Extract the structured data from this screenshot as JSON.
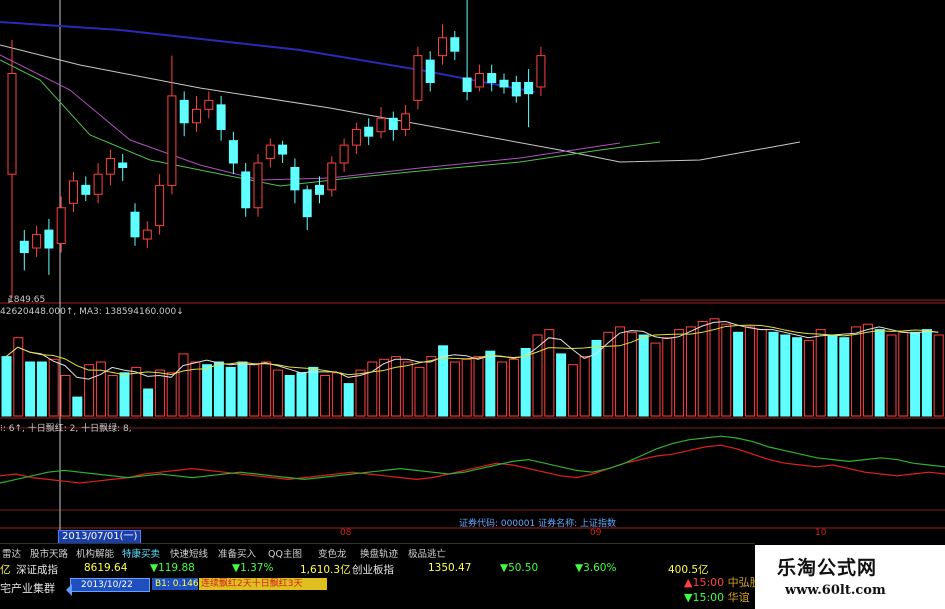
{
  "chart_data": {
    "type": "candlestick",
    "title": "",
    "min_marker": "1849.65",
    "candles": [
      {
        "o": 1905,
        "c": 1950,
        "h": 1965,
        "l": 1849.65
      },
      {
        "o": 1875,
        "c": 1870,
        "h": 1880,
        "l": 1862
      },
      {
        "o": 1872,
        "c": 1878,
        "h": 1882,
        "l": 1868
      },
      {
        "o": 1880,
        "c": 1872,
        "h": 1885,
        "l": 1860
      },
      {
        "o": 1874,
        "c": 1890,
        "h": 1895,
        "l": 1870
      },
      {
        "o": 1892,
        "c": 1902,
        "h": 1906,
        "l": 1888
      },
      {
        "o": 1900,
        "c": 1896,
        "h": 1904,
        "l": 1893
      },
      {
        "o": 1896,
        "c": 1905,
        "h": 1910,
        "l": 1892
      },
      {
        "o": 1905,
        "c": 1912,
        "h": 1916,
        "l": 1900
      },
      {
        "o": 1910,
        "c": 1908,
        "h": 1914,
        "l": 1902
      },
      {
        "o": 1888,
        "c": 1877,
        "h": 1892,
        "l": 1873
      },
      {
        "o": 1876,
        "c": 1880,
        "h": 1884,
        "l": 1872
      },
      {
        "o": 1882,
        "c": 1900,
        "h": 1905,
        "l": 1878
      },
      {
        "o": 1900,
        "c": 1940,
        "h": 1958,
        "l": 1896
      },
      {
        "o": 1938,
        "c": 1928,
        "h": 1942,
        "l": 1922
      },
      {
        "o": 1928,
        "c": 1934,
        "h": 1940,
        "l": 1924
      },
      {
        "o": 1934,
        "c": 1938,
        "h": 1942,
        "l": 1930
      },
      {
        "o": 1936,
        "c": 1925,
        "h": 1940,
        "l": 1920
      },
      {
        "o": 1920,
        "c": 1910,
        "h": 1924,
        "l": 1905
      },
      {
        "o": 1906,
        "c": 1890,
        "h": 1910,
        "l": 1886
      },
      {
        "o": 1890,
        "c": 1910,
        "h": 1914,
        "l": 1886
      },
      {
        "o": 1912,
        "c": 1918,
        "h": 1921,
        "l": 1908
      },
      {
        "o": 1918,
        "c": 1914,
        "h": 1920,
        "l": 1910
      },
      {
        "o": 1908,
        "c": 1898,
        "h": 1912,
        "l": 1892
      },
      {
        "o": 1898,
        "c": 1886,
        "h": 1900,
        "l": 1880
      },
      {
        "o": 1900,
        "c": 1896,
        "h": 1904,
        "l": 1892
      },
      {
        "o": 1898,
        "c": 1910,
        "h": 1913,
        "l": 1895
      },
      {
        "o": 1910,
        "c": 1918,
        "h": 1921,
        "l": 1906
      },
      {
        "o": 1918,
        "c": 1925,
        "h": 1928,
        "l": 1914
      },
      {
        "o": 1926,
        "c": 1922,
        "h": 1930,
        "l": 1918
      },
      {
        "o": 1924,
        "c": 1930,
        "h": 1935,
        "l": 1921
      },
      {
        "o": 1930,
        "c": 1925,
        "h": 1933,
        "l": 1920
      },
      {
        "o": 1925,
        "c": 1932,
        "h": 1936,
        "l": 1922
      },
      {
        "o": 1938,
        "c": 1958,
        "h": 1962,
        "l": 1934
      },
      {
        "o": 1956,
        "c": 1946,
        "h": 1960,
        "l": 1942
      },
      {
        "o": 1958,
        "c": 1966,
        "h": 1972,
        "l": 1954
      },
      {
        "o": 1966,
        "c": 1960,
        "h": 1969,
        "l": 1956
      },
      {
        "o": 1948,
        "c": 1942,
        "h": 2012,
        "l": 1938
      },
      {
        "o": 1944,
        "c": 1950,
        "h": 1954,
        "l": 1942
      },
      {
        "o": 1950,
        "c": 1946,
        "h": 1954,
        "l": 1942
      },
      {
        "o": 1947,
        "c": 1944,
        "h": 1950,
        "l": 1941
      },
      {
        "o": 1946,
        "c": 1940,
        "h": 1949,
        "l": 1937
      },
      {
        "o": 1946,
        "c": 1941,
        "h": 1952,
        "l": 1926
      },
      {
        "o": 1944,
        "c": 1958,
        "h": 1962,
        "l": 1940
      }
    ],
    "volume_label": "42620448.000↑, MA3: 138594160.000↓",
    "volumes": [
      44,
      58,
      40,
      40,
      42,
      30,
      14,
      38,
      40,
      30,
      32,
      36,
      20,
      34,
      32,
      46,
      40,
      38,
      40,
      36,
      40,
      38,
      40,
      34,
      30,
      32,
      36,
      30,
      32,
      24,
      34,
      40,
      42,
      44,
      40,
      36,
      44,
      52,
      40,
      42,
      44,
      48,
      40,
      42,
      50,
      60,
      64,
      46,
      38,
      44,
      56,
      62,
      66,
      62,
      60,
      54,
      58,
      64,
      66,
      70,
      72,
      68,
      62,
      66,
      64,
      62,
      60,
      58,
      56,
      64,
      60,
      58,
      66,
      68,
      64,
      60,
      62,
      62,
      64,
      60
    ],
    "volume_colors": [
      "c",
      "r",
      "c",
      "c",
      "r",
      "r",
      "c",
      "r",
      "r",
      "r",
      "c",
      "r",
      "c",
      "r",
      "r",
      "r",
      "r",
      "c",
      "c",
      "c",
      "c",
      "r",
      "r",
      "r",
      "c",
      "c",
      "c",
      "r",
      "r",
      "c",
      "r",
      "r",
      "r",
      "r",
      "r",
      "r",
      "r",
      "c",
      "r",
      "r",
      "r",
      "c",
      "r",
      "r",
      "c",
      "r",
      "r",
      "c",
      "r",
      "r",
      "c",
      "r",
      "r",
      "r",
      "c",
      "r",
      "r",
      "r",
      "r",
      "r",
      "r",
      "r",
      "c",
      "r",
      "r",
      "c",
      "c",
      "c",
      "r",
      "r",
      "c",
      "c",
      "r",
      "r",
      "c",
      "r",
      "r",
      "c",
      "c",
      "r"
    ],
    "indicator_label": "⁝: 6↑, 十日飘红: 2, 十日飘绿: 8,",
    "red_line": [
      38,
      40,
      36,
      34,
      32,
      30,
      32,
      34,
      36,
      40,
      42,
      44,
      46,
      44,
      42,
      40,
      38,
      36,
      34,
      36,
      38,
      40,
      42,
      40,
      38,
      36,
      34,
      36,
      40,
      44,
      48,
      52,
      50,
      46,
      42,
      38,
      36,
      40,
      46,
      52,
      56,
      60,
      62,
      66,
      70,
      72,
      68,
      62,
      56,
      52,
      50,
      48,
      50,
      46,
      42,
      40,
      38,
      40,
      42,
      40
    ],
    "green_line": [
      30,
      34,
      38,
      42,
      44,
      42,
      40,
      38,
      36,
      38,
      40,
      38,
      36,
      38,
      40,
      42,
      40,
      38,
      36,
      34,
      36,
      38,
      40,
      42,
      44,
      46,
      44,
      42,
      40,
      42,
      46,
      50,
      54,
      56,
      52,
      48,
      44,
      42,
      46,
      52,
      60,
      68,
      74,
      78,
      80,
      82,
      80,
      76,
      70,
      66,
      62,
      58,
      56,
      54,
      56,
      58,
      56,
      52,
      50,
      48
    ],
    "security_info": "证券代码: 000001  证券名称: 上证指数",
    "date_label": "2013/07/01(一)",
    "month_ticks": [
      "08",
      "09",
      "10"
    ]
  },
  "toolbar": [
    "雷达",
    "股市天路",
    "机构解能",
    "特康买卖",
    "快速短线",
    "准备买入",
    "QQ主图",
    "变色龙",
    "换盘轨迹",
    "极品逃亡"
  ],
  "toolbar_active": 3,
  "index_bar": {
    "amount1": "亿",
    "sz_name": "深证成指",
    "sz_value": "8619.64",
    "sz_change": "▼119.88",
    "sz_pct": "▼1.37%",
    "sz_amount": "1,610.3亿",
    "cy_name": "创业板指",
    "cy_value": "1350.47",
    "cy_change": "▼50.50",
    "cy_pct": "▼3.60%",
    "cy_amount": "400.5亿"
  },
  "alert_bar": {
    "left_text": "宅产业集群",
    "alert_date": "2013/10/22",
    "alert_b": "B1: 0.146",
    "alert_msg": "连续飘红2天十日飘红3天"
  },
  "news": [
    {
      "time": "▲15:00",
      "text": "中弘股"
    },
    {
      "time": "▼15:00",
      "text": "华谊"
    }
  ],
  "logo": {
    "title": "乐淘公式网",
    "url": "www.60lt.com"
  }
}
